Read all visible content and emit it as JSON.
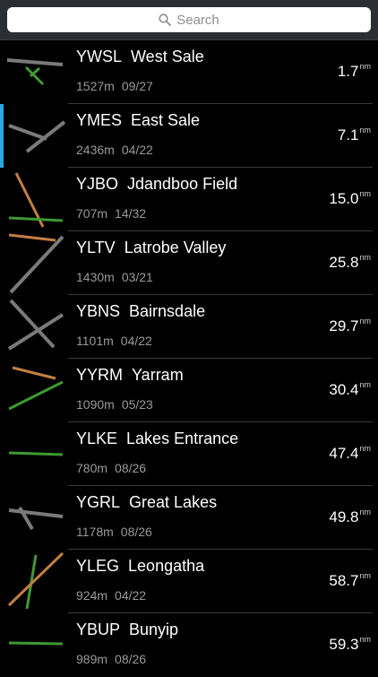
{
  "search": {
    "placeholder": "Search"
  },
  "colors": {
    "sealed_runway": "#7a7a7a",
    "grass_runway": "#3e9a32",
    "gravel_runway": "#c47f43",
    "selected_indicator": "#2ba8e0"
  },
  "airports": [
    {
      "code": "YWSL",
      "name": "West Sale",
      "length": "1527m",
      "runway": "09/27",
      "distance": "1.7",
      "unit": "nm",
      "selected": false
    },
    {
      "code": "YMES",
      "name": "East Sale",
      "length": "2436m",
      "runway": "04/22",
      "distance": "7.1",
      "unit": "nm",
      "selected": true
    },
    {
      "code": "YJBO",
      "name": "Jdandboo Field",
      "length": "707m",
      "runway": "14/32",
      "distance": "15.0",
      "unit": "nm",
      "selected": false
    },
    {
      "code": "YLTV",
      "name": "Latrobe Valley",
      "length": "1430m",
      "runway": "03/21",
      "distance": "25.8",
      "unit": "nm",
      "selected": false
    },
    {
      "code": "YBNS",
      "name": "Bairnsdale",
      "length": "1101m",
      "runway": "04/22",
      "distance": "29.7",
      "unit": "nm",
      "selected": false
    },
    {
      "code": "YYRM",
      "name": "Yarram",
      "length": "1090m",
      "runway": "05/23",
      "distance": "30.4",
      "unit": "nm",
      "selected": false
    },
    {
      "code": "YLKE",
      "name": "Lakes Entrance",
      "length": "780m",
      "runway": "08/26",
      "distance": "47.4",
      "unit": "nm",
      "selected": false
    },
    {
      "code": "YGRL",
      "name": "Great Lakes",
      "length": "1178m",
      "runway": "08/26",
      "distance": "49.8",
      "unit": "nm",
      "selected": false
    },
    {
      "code": "YLEG",
      "name": "Leongatha",
      "length": "924m",
      "runway": "04/22",
      "distance": "58.7",
      "unit": "nm",
      "selected": false
    },
    {
      "code": "YBUP",
      "name": "Bunyip",
      "length": "989m",
      "runway": "08/26",
      "distance": "59.3",
      "unit": "nm",
      "selected": false
    }
  ]
}
